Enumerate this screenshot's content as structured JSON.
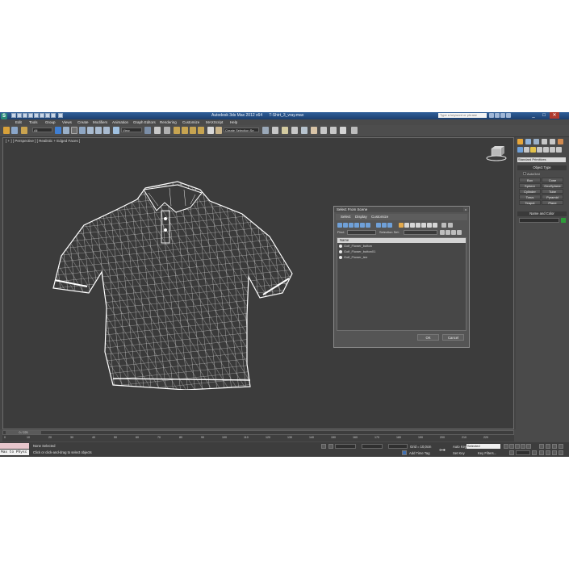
{
  "window": {
    "title": "Autodesk 3ds Max 2012 x64",
    "file_title": "T-Shirt_3_vray.max",
    "search_placeholder": "Type a keyword or phrase",
    "logo_text": "S"
  },
  "menu": [
    "Edit",
    "Tools",
    "Group",
    "Views",
    "Create",
    "Modifiers",
    "Animation",
    "Graph Editors",
    "Rendering",
    "Customize",
    "MAXScript",
    "Help"
  ],
  "toolbar": {
    "selection_filter": "All",
    "ref_coord": "View",
    "named_selection": "Create Selection Se"
  },
  "viewport": {
    "label": "[ + ] [ Perspective ] [ Realistic + Edged Faces ]"
  },
  "command_panel": {
    "category": "Standard Primitives",
    "object_type_title": "Object Type",
    "autogrid_label": "AutoGrid",
    "primitives": [
      "Box",
      "Cone",
      "Sphere",
      "GeoSphere",
      "Cylinder",
      "Tube",
      "Torus",
      "Pyramid",
      "Teapot",
      "Plane"
    ],
    "name_color_title": "Name and Color"
  },
  "dialog": {
    "title": "Select From Scene",
    "close_glyph": "x",
    "menus": [
      "Select",
      "Display",
      "Customize"
    ],
    "find_label": "Find:",
    "selection_set_label": "Selection Set:",
    "column_header": "Name",
    "objects": [
      "Golf_Flower_button",
      "Golf_Flower_button01",
      "Golf_Flower_tee"
    ],
    "ok_label": "OK",
    "cancel_label": "Cancel"
  },
  "timeline": {
    "frame_display": "0 / 225",
    "ticks": [
      "0",
      "10",
      "20",
      "30",
      "40",
      "50",
      "60",
      "70",
      "80",
      "90",
      "100",
      "110",
      "120",
      "130",
      "140",
      "150",
      "160",
      "170",
      "180",
      "190",
      "200",
      "210",
      "220"
    ]
  },
  "status": {
    "maxscript_label": "Max to Physc",
    "selection_text": "None Selected",
    "prompt_text": "Click or click-and-drag to select objects",
    "grid_text": "Grid = 10,0cm",
    "add_time_tag": "Add Time Tag",
    "auto_key": "Auto Key",
    "auto_key_mode": "Selected",
    "set_key": "Set Key",
    "key_filters": "Key Filters..."
  },
  "colors": {
    "app_bg": "#444444",
    "viewport_bg": "#3c3c3c",
    "titlebar": "#2f5f9a",
    "object_color": "#2e9d3a"
  }
}
